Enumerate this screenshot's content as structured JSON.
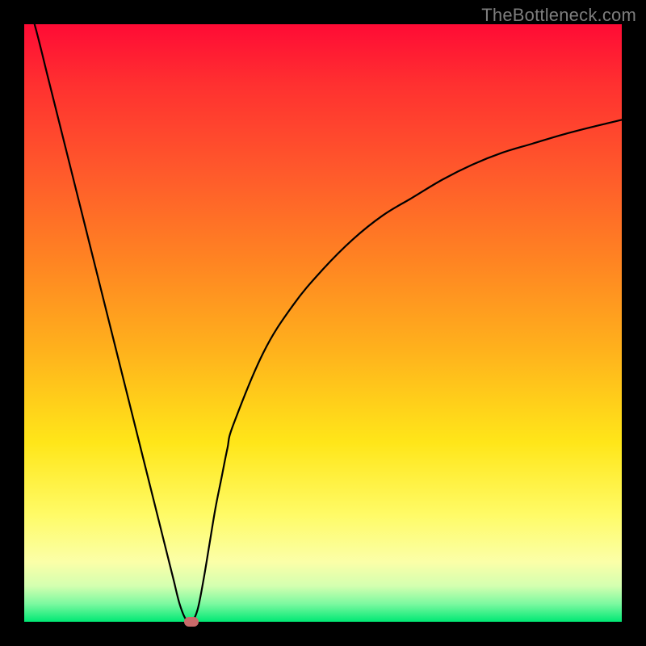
{
  "watermark": {
    "text": "TheBottleneck.com"
  },
  "colors": {
    "frame": "#000000",
    "gradient_stops": [
      "#ff0b35",
      "#ff3030",
      "#ff5a2b",
      "#ff8522",
      "#ffb31c",
      "#ffe619",
      "#fffb66",
      "#fbffa8",
      "#d4ffb0",
      "#7cf9a0",
      "#00e874"
    ],
    "curve": "#000000",
    "marker": "#c96a6a"
  },
  "chart_data": {
    "type": "line",
    "title": "",
    "xlabel": "",
    "ylabel": "",
    "xlim": [
      0,
      100
    ],
    "ylim": [
      0,
      100
    ],
    "x": [
      0,
      2,
      4,
      6,
      8,
      10,
      12,
      14,
      16,
      18,
      20,
      22,
      24,
      25,
      26,
      27,
      28,
      29,
      30,
      31,
      32,
      33,
      34,
      35,
      40,
      45,
      50,
      55,
      60,
      65,
      70,
      75,
      80,
      85,
      90,
      95,
      100
    ],
    "values": [
      106,
      99,
      91,
      83,
      75,
      67,
      59,
      51,
      43,
      35,
      27,
      19,
      11,
      7,
      3,
      0.5,
      0,
      2,
      7,
      13,
      19,
      24,
      29,
      33,
      45,
      53,
      59,
      64,
      68,
      71,
      74,
      76.5,
      78.5,
      80,
      81.5,
      82.8,
      84
    ],
    "marker": {
      "x": 28,
      "y": 0
    }
  }
}
